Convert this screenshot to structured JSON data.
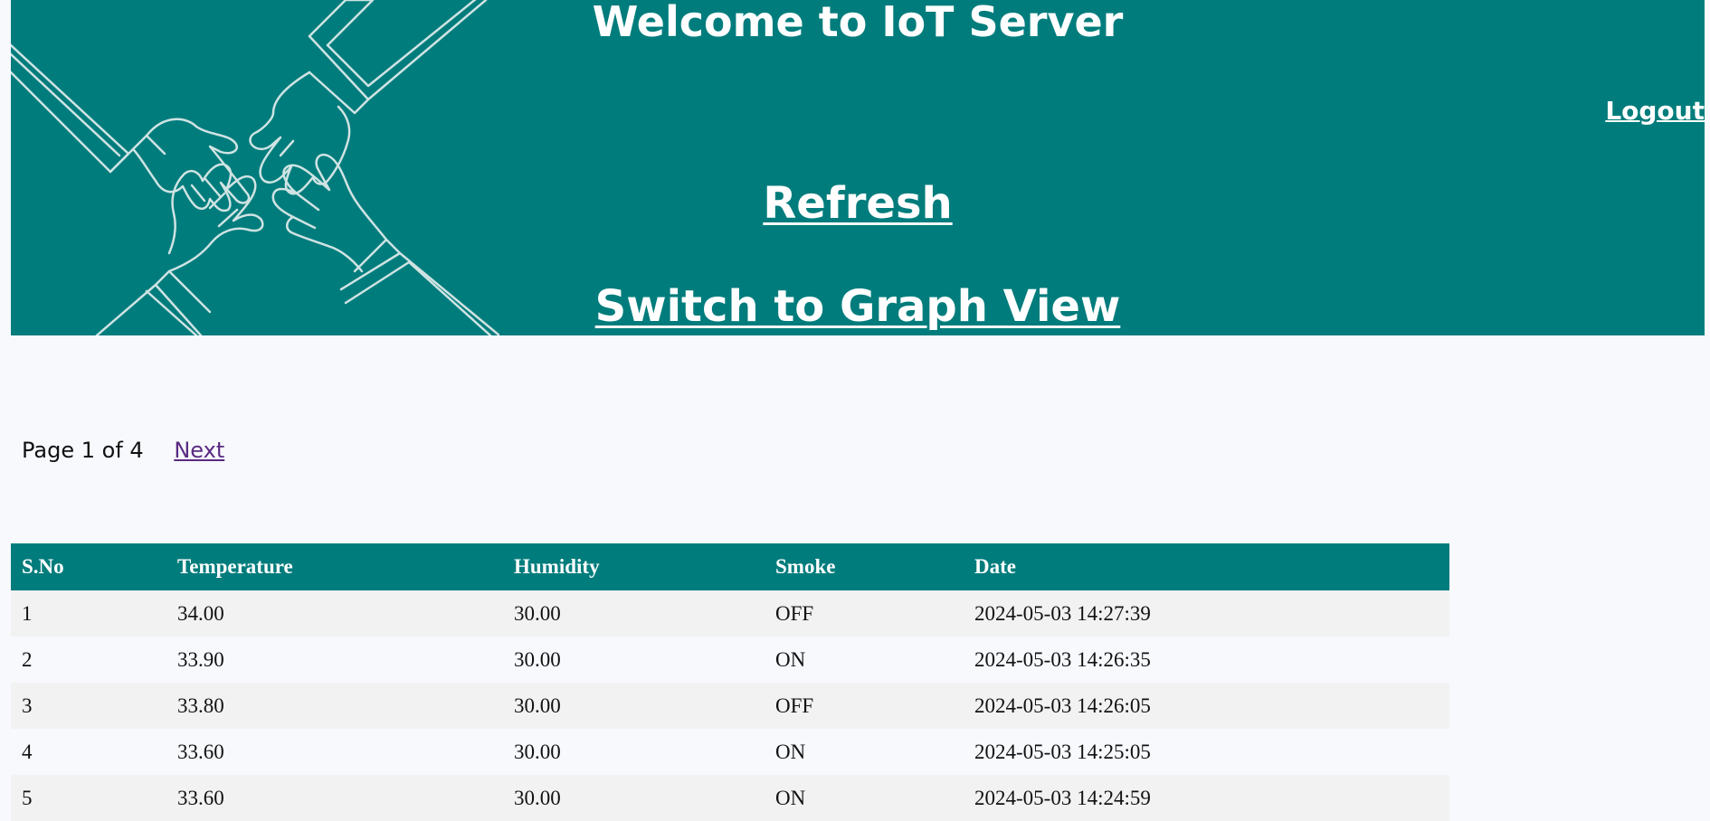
{
  "header": {
    "title": "Welcome to IoT Server",
    "logout_label": "Logout",
    "refresh_label": "Refresh",
    "graph_view_label": "Switch to Graph View",
    "background_color": "#007c7c",
    "illustration": "hands-teamwork-illustration"
  },
  "pagination": {
    "status": "Page 1 of 4",
    "next_label": "Next"
  },
  "table": {
    "headers": [
      "S.No",
      "Temperature",
      "Humidity",
      "Smoke",
      "Date"
    ],
    "rows": [
      [
        "1",
        "34.00",
        "30.00",
        "OFF",
        "2024-05-03 14:27:39"
      ],
      [
        "2",
        "33.90",
        "30.00",
        "ON",
        "2024-05-03 14:26:35"
      ],
      [
        "3",
        "33.80",
        "30.00",
        "OFF",
        "2024-05-03 14:26:05"
      ],
      [
        "4",
        "33.60",
        "30.00",
        "ON",
        "2024-05-03 14:25:05"
      ],
      [
        "5",
        "33.60",
        "30.00",
        "ON",
        "2024-05-03 14:24:59"
      ]
    ]
  }
}
